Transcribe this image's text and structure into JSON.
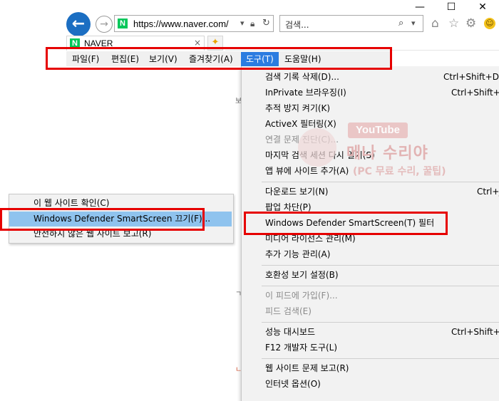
{
  "window_controls": {
    "minimize": "—",
    "maximize": "☐",
    "close": "✕"
  },
  "toolbar": {
    "back_icon": "arrow-left-icon",
    "forward_icon": "arrow-right-icon",
    "address_url": "https://www.naver.com/",
    "search_placeholder": "검색...",
    "site_icon_letter": "N",
    "brand_color": "#03c75a"
  },
  "tab": {
    "title": "NAVER",
    "close": "×"
  },
  "menubar": {
    "items": [
      {
        "label": "파일(F)"
      },
      {
        "label": "편집(E)"
      },
      {
        "label": "보기(V)"
      },
      {
        "label": "즐겨찾기(A)"
      },
      {
        "label": "도구(T)",
        "active": true
      },
      {
        "label": "도움말(H)"
      }
    ]
  },
  "tools_menu": {
    "items": [
      {
        "label": "검색 기록 삭제(D)...",
        "shortcut": "Ctrl+Shift+Del"
      },
      {
        "label": "InPrivate 브라우징(I)",
        "shortcut": "Ctrl+Shift+P"
      },
      {
        "label": "추적 방지 켜기(K)"
      },
      {
        "label": "ActiveX 필터링(X)"
      },
      {
        "label": "연결 문제 진단(C)...",
        "disabled": true
      },
      {
        "label": "마지막 검색 세션 다시 열기(S)"
      },
      {
        "label": "앱 뷰에 사이트 추가(A)"
      },
      {
        "label": "다운로드 보기(N)",
        "shortcut": "Ctrl+J"
      },
      {
        "label": "팝업 차단(P)"
      },
      {
        "label": "Windows Defender SmartScreen(T) 필터"
      },
      {
        "label": "미디어 라이선스 관리(M)"
      },
      {
        "label": "추가 기능 관리(A)"
      },
      {
        "label": "호환성 보기 설정(B)"
      },
      {
        "label": "이 피드에 가입(F)...",
        "disabled": true
      },
      {
        "label": "피드 검색(E)",
        "disabled": true
      },
      {
        "label": "성능 대시보드",
        "shortcut": "Ctrl+Shift+U"
      },
      {
        "label": "F12 개발자 도구(L)"
      },
      {
        "label": "웹 사이트 문제 보고(R)"
      },
      {
        "label": "인터넷 옵션(O)"
      }
    ]
  },
  "smartscreen_submenu": {
    "items": [
      {
        "label": "이 웹 사이트 확인(C)"
      },
      {
        "label": "Windows Defender SmartScreen 끄기(F)...",
        "highlighted": true
      },
      {
        "label": "안전하지 않은 웹 사이트 보고(R)"
      }
    ]
  },
  "watermark": {
    "platform": "YouTube",
    "title": "메나 수리야",
    "subtitle": "(PC 무료 수리, 꿀팁)"
  },
  "annotation_color": "#e60000",
  "accent_color": "#2b7ce0"
}
